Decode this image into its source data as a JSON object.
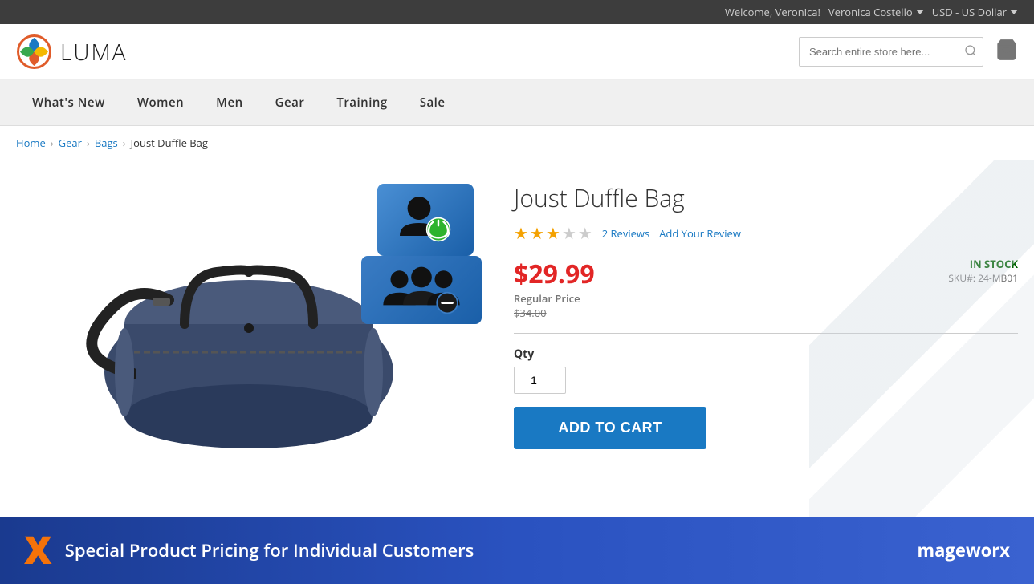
{
  "topbar": {
    "welcome": "Welcome, Veronica!",
    "user_name": "Veronica Costello",
    "currency": "USD - US Dollar"
  },
  "header": {
    "logo_text": "LUMA",
    "search_placeholder": "Search entire store here...",
    "cart_label": "Cart"
  },
  "nav": {
    "items": [
      {
        "label": "What's New",
        "id": "whats-new"
      },
      {
        "label": "Women",
        "id": "women"
      },
      {
        "label": "Men",
        "id": "men"
      },
      {
        "label": "Gear",
        "id": "gear"
      },
      {
        "label": "Training",
        "id": "training"
      },
      {
        "label": "Sale",
        "id": "sale"
      }
    ]
  },
  "breadcrumb": {
    "items": [
      {
        "label": "Home",
        "href": "#"
      },
      {
        "label": "Gear",
        "href": "#"
      },
      {
        "label": "Bags",
        "href": "#"
      },
      {
        "label": "Joust Duffle Bag",
        "href": null
      }
    ]
  },
  "product": {
    "title": "Joust Duffle Bag",
    "rating": 3,
    "max_rating": 5,
    "reviews_count": "2 Reviews",
    "add_review_label": "Add Your Review",
    "sale_price": "$29.99",
    "regular_price_label": "Regular Price",
    "regular_price": "$34.00",
    "stock_status": "IN STOCK",
    "sku_label": "SKU#:",
    "sku": "24-MB01",
    "qty_label": "Qty",
    "qty_value": "1",
    "add_to_cart_label": "Add to Cart"
  },
  "banner": {
    "x_icon": "X",
    "text": "Special Product Pricing for Individual Customers",
    "brand": "mageworx"
  }
}
